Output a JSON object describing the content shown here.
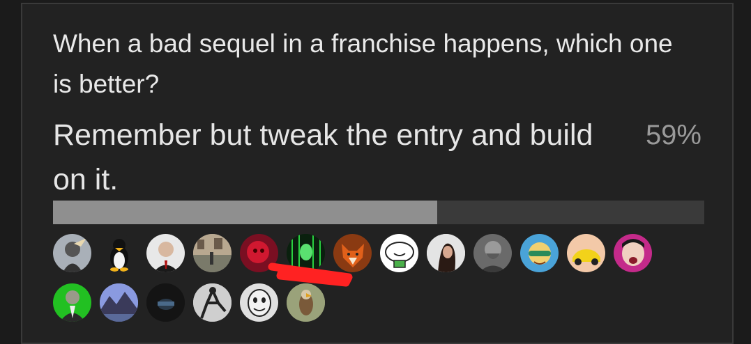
{
  "poll": {
    "question": "When a bad sequel in a franchise happens, which one is better?",
    "option": {
      "text": "Remember but tweak the entry and build on it.",
      "percent_label": "59%",
      "fraction": 0.59
    }
  },
  "voters": [
    {
      "name": "voter-avatar-shark-suit",
      "bg": "#a9b0b8"
    },
    {
      "name": "voter-avatar-tux-penguin",
      "bg": "#222222"
    },
    {
      "name": "voter-avatar-bald-man",
      "bg": "#e8e8e8"
    },
    {
      "name": "voter-avatar-street",
      "bg": "#9a8f82"
    },
    {
      "name": "voter-avatar-red-face",
      "bg": "#7a0f22"
    },
    {
      "name": "voter-avatar-green-matrix",
      "bg": "#0d2a12"
    },
    {
      "name": "voter-avatar-fox",
      "bg": "#8a3a12"
    },
    {
      "name": "voter-avatar-white-blob",
      "bg": "#ffffff"
    },
    {
      "name": "voter-avatar-woman-portrait",
      "bg": "#d8d8d8"
    },
    {
      "name": "voter-avatar-bearded-man",
      "bg": "#6a6a6a"
    },
    {
      "name": "voter-avatar-cartoon-sunglasses",
      "bg": "#4aa3d8"
    },
    {
      "name": "voter-avatar-yellow-car",
      "bg": "#f3c9a8"
    },
    {
      "name": "voter-avatar-pink-face",
      "bg": "#c42a8a"
    },
    {
      "name": "voter-avatar-green-suit",
      "bg": "#22c022"
    },
    {
      "name": "voter-avatar-mountain",
      "bg": "#6a7bd0"
    },
    {
      "name": "voter-avatar-dark-gamer",
      "bg": "#1a1a1a"
    },
    {
      "name": "voter-avatar-dancer",
      "bg": "#d0d0d0"
    },
    {
      "name": "voter-avatar-mask",
      "bg": "#e0e0e0"
    },
    {
      "name": "voter-avatar-hawk",
      "bg": "#8a9a6a"
    }
  ],
  "colors": {
    "card_bg": "#222222",
    "bar_track": "#3a3a3a",
    "bar_fill": "#8f8f8f",
    "scribble": "#ff2222"
  }
}
